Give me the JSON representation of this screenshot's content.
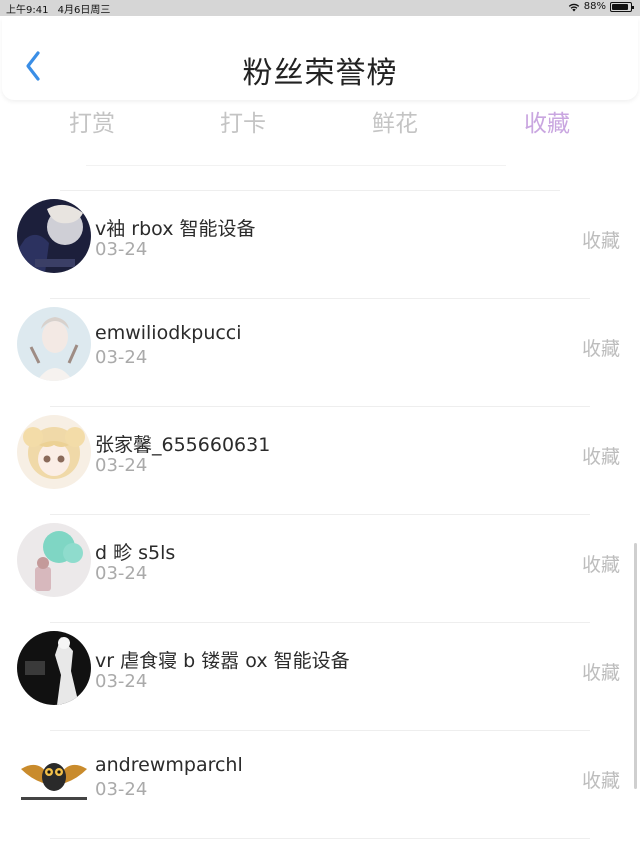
{
  "status_bar": {
    "time": "上午9:41",
    "date": "4月6日周三",
    "battery": "88%"
  },
  "header": {
    "title": "粉丝荣誉榜"
  },
  "tabs": [
    {
      "label": "打赏",
      "active": false
    },
    {
      "label": "打卡",
      "active": false
    },
    {
      "label": "鲜花",
      "active": false
    },
    {
      "label": "收藏",
      "active": true
    }
  ],
  "fans": [
    {
      "name": "v袖 rbox 智能设备",
      "date": "03-24",
      "action": "收藏",
      "avatar": "dark-portrait-avatar"
    },
    {
      "name": "emwiliodkpucci",
      "date": "03-24",
      "action": "收藏",
      "avatar": "light-portrait-avatar"
    },
    {
      "name": "张家馨_655660631",
      "date": "03-24",
      "action": "收藏",
      "avatar": "anime-girl-avatar"
    },
    {
      "name": "d 畛 s5ls",
      "date": "03-24",
      "action": "收藏",
      "avatar": "painting-avatar"
    },
    {
      "name": "vr 虐食寝 b 镂嚣 ox 智能设备",
      "date": "03-24",
      "action": "收藏",
      "avatar": "monochrome-figure-avatar"
    },
    {
      "name": "andrewmparchl",
      "date": "03-24",
      "action": "收藏",
      "avatar": "owl-logo-avatar"
    }
  ],
  "colors": {
    "accent": "#c9a6e0",
    "back": "#3a8ee6",
    "muted": "#c4c4c4"
  }
}
